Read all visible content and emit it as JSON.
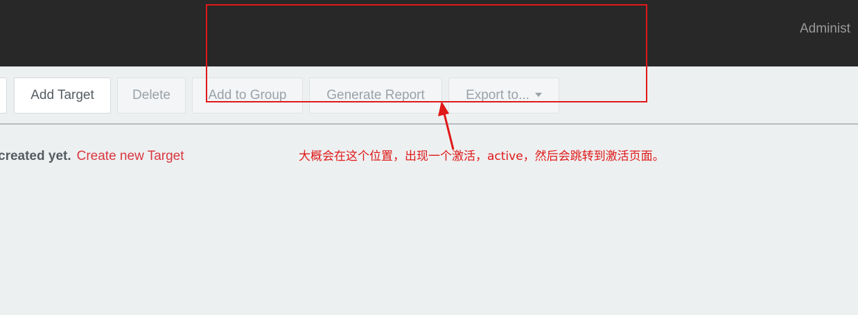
{
  "header": {
    "admin_label": "Administ"
  },
  "toolbar": {
    "add_target_label": "Add Target",
    "delete_label": "Delete",
    "add_to_group_label": "Add to Group",
    "generate_report_label": "Generate Report",
    "export_label": "Export to..."
  },
  "main": {
    "empty_text": "created yet.",
    "create_link_label": "Create new Target"
  },
  "annotation": {
    "note": "大概会在这个位置，出现一个激活，active，然后会跳转到激活页面。",
    "color": "#e01818"
  },
  "colors": {
    "topbar_bg": "#282828",
    "page_bg": "#edf0f1",
    "link_red": "#d9363e"
  }
}
